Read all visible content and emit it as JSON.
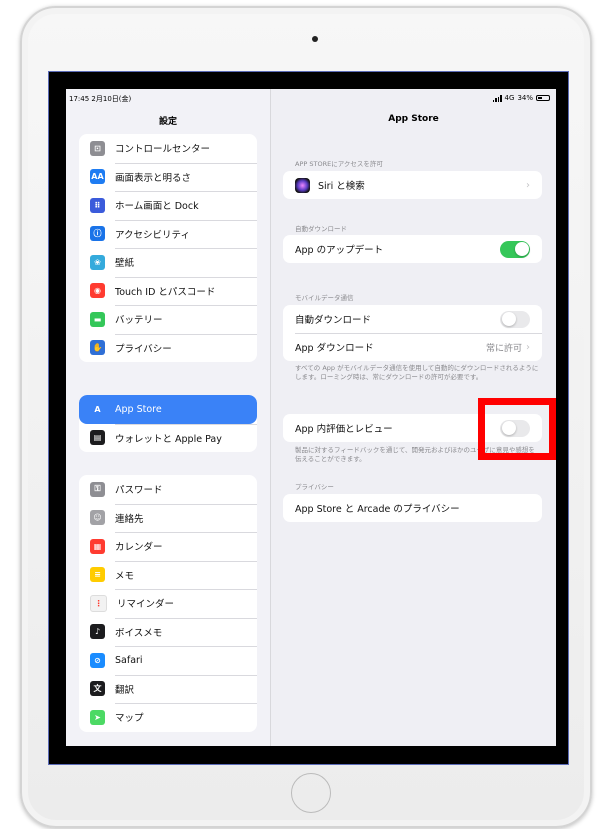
{
  "status_bar": {
    "time": "17:45",
    "date": "2月10日(金)",
    "network": "4G",
    "battery": "34%"
  },
  "sidebar": {
    "title": "設定",
    "groups": [
      {
        "items": [
          {
            "label": "コントロールセンター",
            "icon": "control-center-icon",
            "color": "#8e8e93",
            "glyph": "⊡"
          },
          {
            "label": "画面表示と明るさ",
            "icon": "display-brightness-icon",
            "color": "#1e7cf2",
            "glyph": "AA"
          },
          {
            "label": "ホーム画面と Dock",
            "icon": "home-screen-icon",
            "color": "#3b5bdb",
            "glyph": "⠿"
          },
          {
            "label": "アクセシビリティ",
            "icon": "accessibility-icon",
            "color": "#1a73e8",
            "glyph": "ⓘ"
          },
          {
            "label": "壁紙",
            "icon": "wallpaper-icon",
            "color": "#34aadc",
            "glyph": "❀"
          },
          {
            "label": "Touch ID とパスコード",
            "icon": "fingerprint-icon",
            "color": "#ff3b30",
            "glyph": "◉"
          },
          {
            "label": "バッテリー",
            "icon": "battery-icon",
            "color": "#34c759",
            "glyph": "▬"
          },
          {
            "label": "プライバシー",
            "icon": "privacy-hand-icon",
            "color": "#2f6fd6",
            "glyph": "✋"
          }
        ]
      },
      {
        "items": [
          {
            "label": "App Store",
            "icon": "app-store-icon",
            "color": "#3a82f7",
            "glyph": "A",
            "selected": true
          },
          {
            "label": "ウォレットと Apple Pay",
            "icon": "wallet-icon",
            "color": "#1c1c1e",
            "glyph": "▤"
          }
        ]
      },
      {
        "items": [
          {
            "label": "パスワード",
            "icon": "key-icon",
            "color": "#8e8e93",
            "glyph": "⚿"
          },
          {
            "label": "連絡先",
            "icon": "contacts-icon",
            "color": "#a2a2a6",
            "glyph": "☺"
          },
          {
            "label": "カレンダー",
            "icon": "calendar-icon",
            "color": "#ff3b30",
            "glyph": "▦"
          },
          {
            "label": "メモ",
            "icon": "notes-icon",
            "color": "#ffcc00",
            "glyph": "≡"
          },
          {
            "label": "リマインダー",
            "icon": "reminders-icon",
            "color": "#f2f2f2",
            "glyph": "⋮"
          },
          {
            "label": "ボイスメモ",
            "icon": "voice-memo-icon",
            "color": "#1c1c1e",
            "glyph": "♪"
          },
          {
            "label": "Safari",
            "icon": "safari-icon",
            "color": "#1a8cff",
            "glyph": "⊘"
          },
          {
            "label": "翻訳",
            "icon": "translate-icon",
            "color": "#1c1c1e",
            "glyph": "文"
          },
          {
            "label": "マップ",
            "icon": "maps-icon",
            "color": "#4cd964",
            "glyph": "➤"
          }
        ]
      }
    ]
  },
  "detail": {
    "title": "App Store",
    "access_header": "APP STOREにアクセスを許可",
    "siri_label": "Siri と検索",
    "auto_dl_header": "自動ダウンロード",
    "app_update_label": "App のアップデート",
    "app_update_on": true,
    "cellular_header": "モバイルデータ通信",
    "auto_download_label": "自動ダウンロード",
    "auto_download_on": false,
    "app_download_label": "App ダウンロード",
    "app_download_value": "常に許可",
    "cellular_footer": "すべての App がモバイルデータ通信を使用して自動的にダウンロードされるようにします。ローミング時は、常にダウンロードの許可が必要です。",
    "ratings_label": "App 内評価とレビュー",
    "ratings_on": false,
    "ratings_footer": "製品に対するフィードバックを通じて、開発元およびほかのユーザに意見や感想を伝えることができます。",
    "privacy_header": "プライバシー",
    "privacy_link": "App Store と Arcade のプライバシー"
  },
  "highlight_color": "#ff0000"
}
